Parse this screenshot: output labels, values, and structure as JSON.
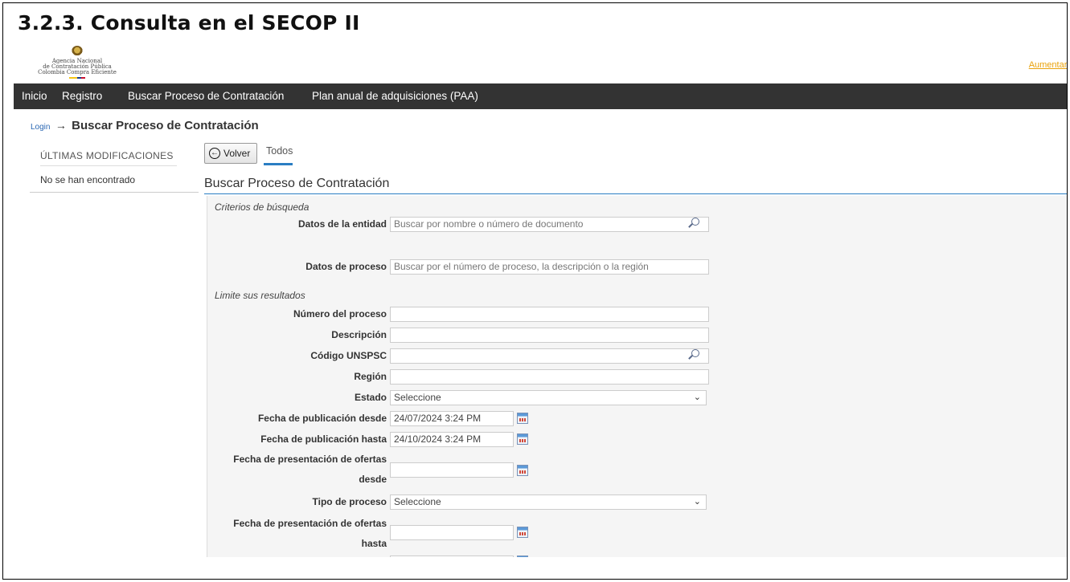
{
  "doc_heading": "3.2.3. Consulta en el SECOP II",
  "logo": {
    "line1": "Agencia Nacional",
    "line2": "de Contratación Pública",
    "line3": "Colombia Compra Eficiente"
  },
  "header_link": "Aumentar el",
  "nav": [
    "Inicio",
    "Registro",
    "Buscar Proceso de Contratación",
    "Plan anual de adquisiciones (PAA)"
  ],
  "breadcrumb": {
    "login": "Login",
    "arrow": "→",
    "title": "Buscar Proceso de Contratación"
  },
  "left_panel": {
    "title": "ÚLTIMAS MODIFICACIONES",
    "empty": "No se han encontrado"
  },
  "toolbar": {
    "back_label": "Volver",
    "back_icon": "arrow-left-circle-icon",
    "tab": "Todos"
  },
  "section_title": "Buscar Proceso de Contratación",
  "form": {
    "criteria_label": "Criterios de búsqueda",
    "entidad": {
      "label": "Datos de la entidad",
      "value": "",
      "placeholder": "Buscar por nombre o número de documento"
    },
    "proceso_data": {
      "label": "Datos de proceso",
      "value": "",
      "placeholder": "Buscar por el número de proceso, la descripción o la región"
    },
    "limit_label": "Limite sus resultados",
    "numero": {
      "label": "Número del proceso",
      "value": ""
    },
    "descripcion": {
      "label": "Descripción",
      "value": ""
    },
    "unspsc": {
      "label": "Código UNSPSC",
      "value": ""
    },
    "region": {
      "label": "Región",
      "value": ""
    },
    "estado": {
      "label": "Estado",
      "selected": "Seleccione"
    },
    "pub_desde": {
      "label": "Fecha de publicación desde",
      "value": "24/07/2024 3:24 PM"
    },
    "pub_hasta": {
      "label": "Fecha de publicación hasta",
      "value": "24/10/2024 3:24 PM"
    },
    "ofertas_desde": {
      "label_line1": "Fecha de presentación de ofertas",
      "label_line2": "desde",
      "value": ""
    },
    "tipo": {
      "label": "Tipo de proceso",
      "selected": "Seleccione"
    },
    "ofertas_hasta": {
      "label_line1": "Fecha de presentación de ofertas",
      "label_line2": "hasta",
      "value": ""
    }
  },
  "icons": {
    "search": "search-icon",
    "calendar": "calendar-icon",
    "dropdown": "chevron-down-icon"
  },
  "colors": {
    "navbar": "#333333",
    "accent": "#2a7ec3",
    "link": "#e9a20b"
  }
}
